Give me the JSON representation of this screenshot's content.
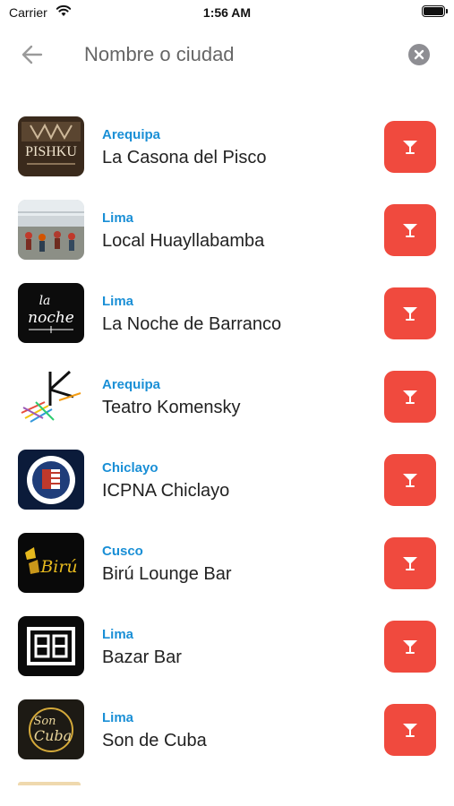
{
  "status_bar": {
    "carrier": "Carrier",
    "time": "1:56 AM"
  },
  "search": {
    "placeholder": "Nombre o ciudad",
    "value": ""
  },
  "venues": [
    {
      "city": "Arequipa",
      "name": "La Casona del Pisco",
      "logo": "pishku-logo"
    },
    {
      "city": "Lima",
      "name": "Local Huayllabamba",
      "logo": "huayllabamba-photo"
    },
    {
      "city": "Lima",
      "name": "La Noche de Barranco",
      "logo": "la-noche-logo"
    },
    {
      "city": "Arequipa",
      "name": "Teatro Komensky",
      "logo": "komensky-logo"
    },
    {
      "city": "Chiclayo",
      "name": "ICPNA Chiclayo",
      "logo": "icpna-logo"
    },
    {
      "city": "Cusco",
      "name": "Birú Lounge Bar",
      "logo": "biru-logo"
    },
    {
      "city": "Lima",
      "name": "Bazar Bar",
      "logo": "bazar-logo"
    },
    {
      "city": "Lima",
      "name": "Son de Cuba",
      "logo": "son-de-cuba-logo"
    }
  ],
  "logo_text": {
    "pishku": "PISHKU",
    "la_noche_1": "la",
    "la_noche_2": "noche",
    "son_de_cuba_1": "Son",
    "son_de_cuba_2": "Cuba",
    "biru": "Birú"
  },
  "colors": {
    "accent": "#1a8fd6",
    "action": "#f04a3e"
  },
  "action_icon": "cocktail-glass-icon"
}
